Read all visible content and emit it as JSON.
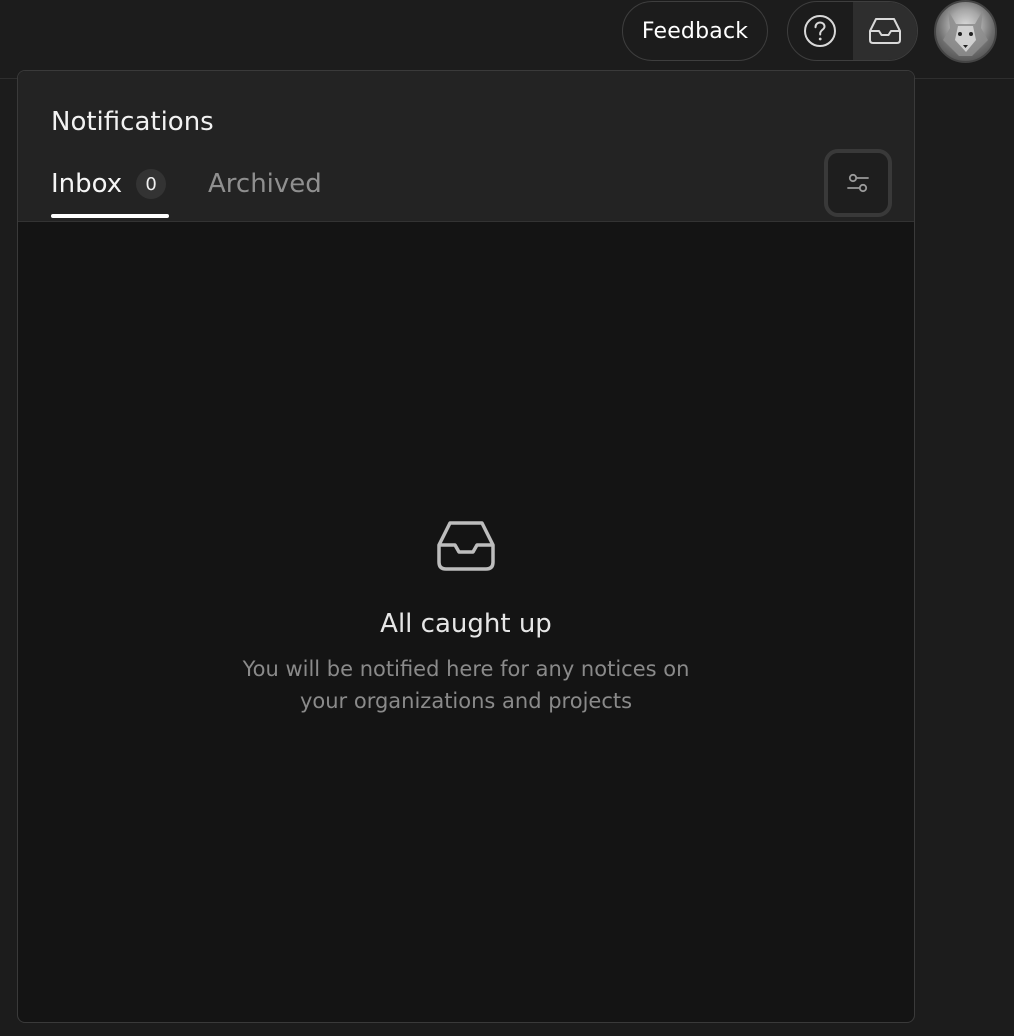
{
  "topbar": {
    "feedback_label": "Feedback",
    "icons": {
      "help": "help-circle-icon",
      "inbox": "inbox-icon"
    },
    "avatar_alt": "wolf avatar"
  },
  "panel": {
    "title": "Notifications",
    "tabs": [
      {
        "label": "Inbox",
        "count": "0",
        "active": true
      },
      {
        "label": "Archived",
        "active": false
      }
    ],
    "filter_icon": "sliders-icon",
    "empty": {
      "icon": "inbox-icon",
      "title": "All caught up",
      "description": "You will be notified here for any notices on your organizations and projects"
    }
  },
  "colors": {
    "background": "#1c1c1c",
    "panel": "#141414",
    "panel_header": "#232323",
    "text_muted": "#8a8a8a"
  }
}
